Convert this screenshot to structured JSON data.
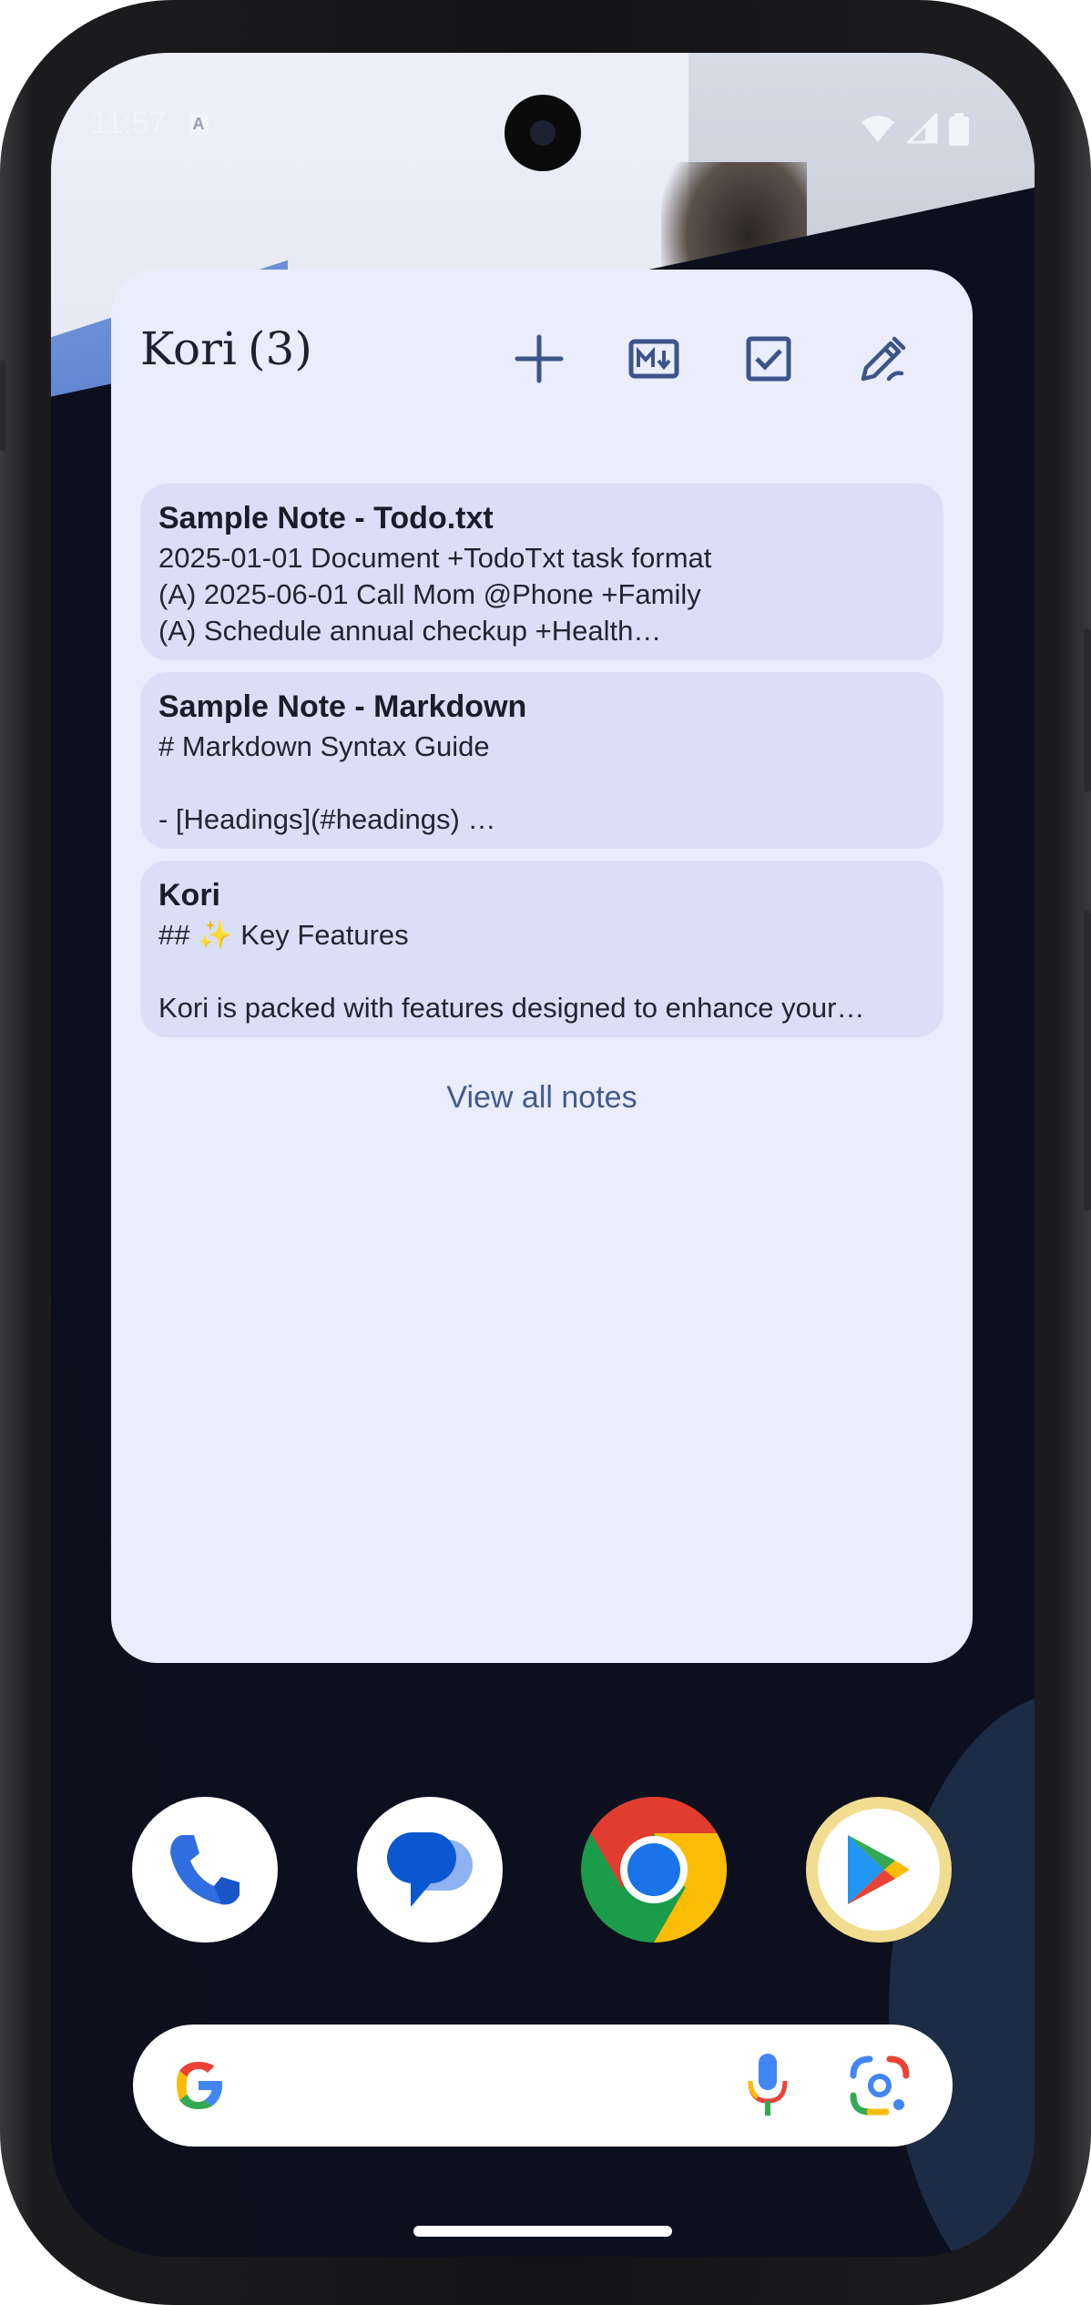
{
  "status_bar": {
    "time": "11:57",
    "notification_badge": "A",
    "icons": [
      "wifi-icon",
      "signal-icon",
      "battery-icon"
    ]
  },
  "widget": {
    "title": "Kori",
    "count": "(3)",
    "toolbar": [
      {
        "name": "add-note-button",
        "icon": "plus-icon"
      },
      {
        "name": "new-markdown-button",
        "icon": "markdown-icon"
      },
      {
        "name": "new-todo-button",
        "icon": "checkbox-icon"
      },
      {
        "name": "edit-button",
        "icon": "pen-icon"
      }
    ],
    "notes": [
      {
        "title": "Sample Note - Todo.txt",
        "lines": [
          "2025-01-01 Document +TodoTxt task format",
          "(A) 2025-06-01 Call Mom @Phone +Family",
          "(A) Schedule annual checkup +Health…"
        ]
      },
      {
        "title": "Sample Note - Markdown",
        "lines": [
          "# Markdown Syntax Guide",
          "",
          "- [Headings](#headings)  …"
        ]
      },
      {
        "title": "Kori",
        "lines": [
          "## ✨ Key Features",
          "",
          "Kori is packed with features designed to enhance your…"
        ]
      }
    ],
    "view_all_label": "View all notes"
  },
  "dock": [
    {
      "name": "phone-app",
      "icon": "phone-icon"
    },
    {
      "name": "messages-app",
      "icon": "messages-icon"
    },
    {
      "name": "chrome-app",
      "icon": "chrome-icon"
    },
    {
      "name": "play-store-app",
      "icon": "play-store-icon"
    }
  ],
  "search_bar": {
    "icons": [
      "google-icon",
      "microphone-icon",
      "lens-icon"
    ]
  },
  "colors": {
    "widget_bg": "#eaedfc",
    "note_bg": "#dadff7",
    "accent": "#435a8a"
  }
}
